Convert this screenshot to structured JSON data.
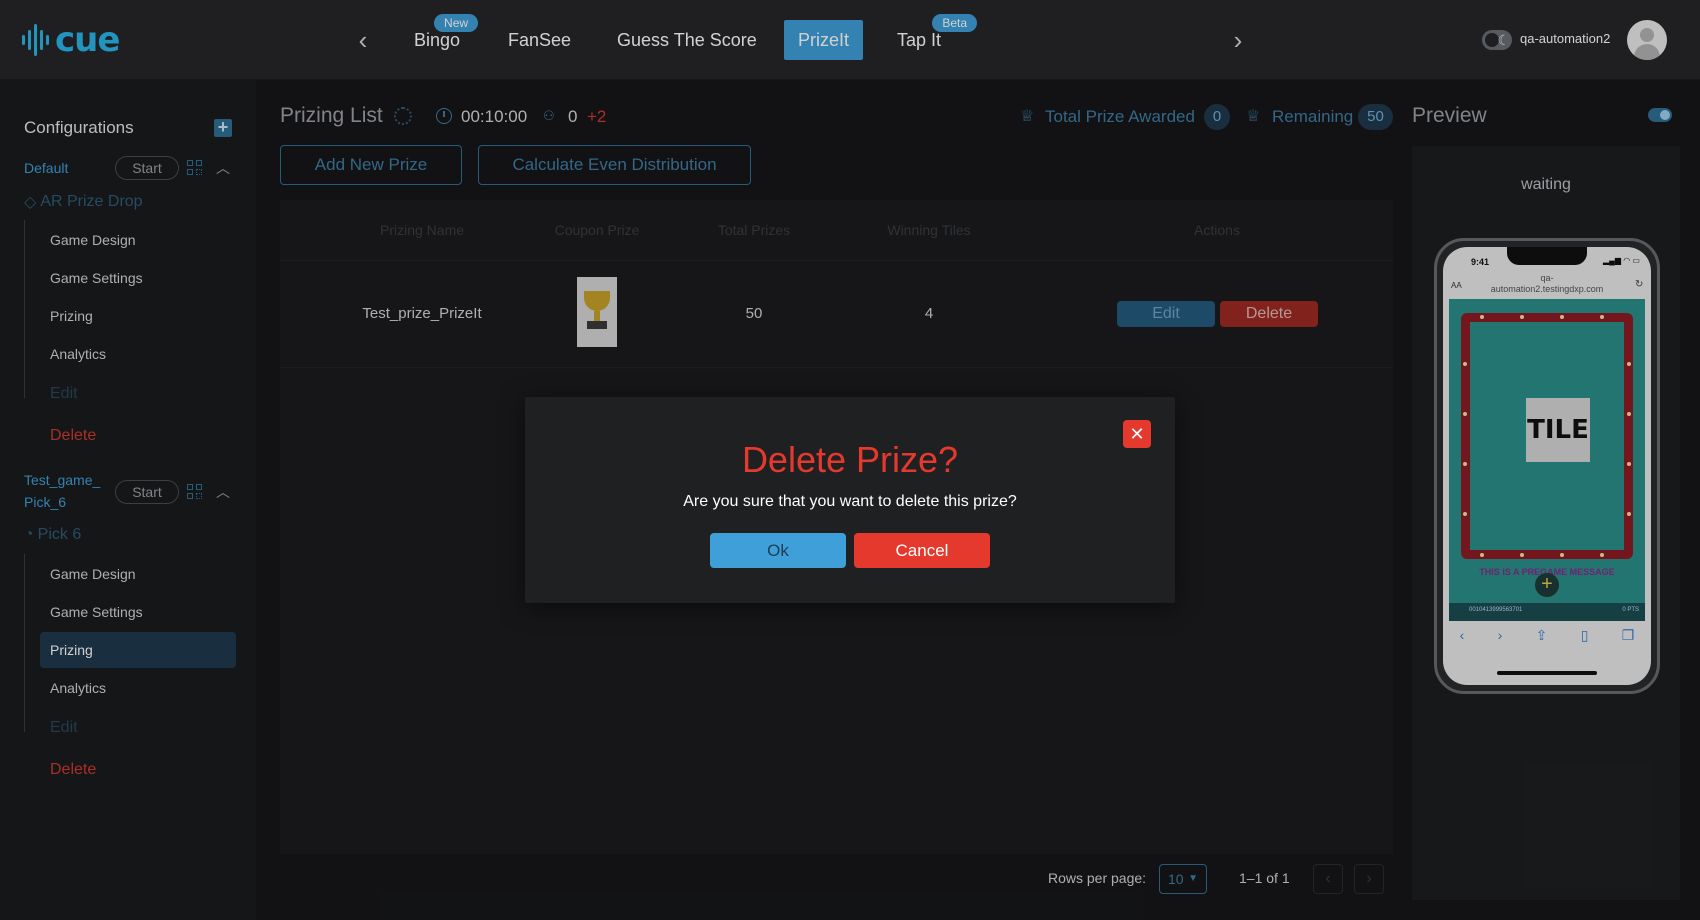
{
  "brand": {
    "name": "cue",
    "color": "#2ab6ea"
  },
  "topnav": {
    "tabs": [
      {
        "label": "Bingo",
        "badge": "New"
      },
      {
        "label": "FanSee"
      },
      {
        "label": "Guess The Score"
      },
      {
        "label": "PrizeIt",
        "active": true
      },
      {
        "label": "Tap It",
        "badge": "Beta"
      }
    ],
    "username": "qa-automation2"
  },
  "sidebar": {
    "title": "Configurations",
    "configs": [
      {
        "name": "Default",
        "start_label": "Start",
        "game_type": "AR Prize Drop",
        "items": [
          "Game Design",
          "Game Settings",
          "Prizing",
          "Analytics",
          "Edit",
          "Delete"
        ]
      },
      {
        "name_line1": "Test_game_",
        "name_line2": "Pick_6",
        "start_label": "Start",
        "game_type": "Pick 6",
        "items": [
          "Game Design",
          "Game Settings",
          "Prizing",
          "Analytics",
          "Edit",
          "Delete"
        ],
        "active_item": "Prizing"
      }
    ]
  },
  "main": {
    "title": "Prizing List",
    "timer": "00:10:00",
    "users_count": "0",
    "users_delta": "+2",
    "total_awarded_label": "Total Prize Awarded",
    "total_awarded_value": "0",
    "remaining_label": "Remaining",
    "remaining_value": "50",
    "add_button": "Add New Prize",
    "calc_button": "Calculate Even Distribution",
    "table": {
      "headers": [
        "Prizing Name",
        "Coupon Prize",
        "Total Prizes",
        "Winning Tiles",
        "Actions"
      ],
      "rows": [
        {
          "name": "Test_prize_PrizeIt",
          "total": "50",
          "tiles": "4",
          "edit": "Edit",
          "delete": "Delete"
        }
      ]
    },
    "pagination": {
      "rows_label": "Rows per page:",
      "rows_value": "10",
      "range": "1–1 of 1"
    }
  },
  "preview": {
    "title": "Preview",
    "status": "waiting",
    "phone": {
      "time": "9:41",
      "url_line1": "qa-",
      "url_line2": "automation2.testingdxp.com",
      "aa": "AA",
      "tile": "TILE",
      "message": "THIS IS A PREGAME MESSAGE",
      "footer_left": "0010413999563701",
      "footer_right": "0 PTS"
    }
  },
  "modal": {
    "title": "Delete Prize?",
    "text": "Are you sure that you want to delete this prize?",
    "ok": "Ok",
    "cancel": "Cancel"
  },
  "colors": {
    "accent": "#3f9fd8",
    "danger": "#e5392e",
    "background": "#161719"
  }
}
